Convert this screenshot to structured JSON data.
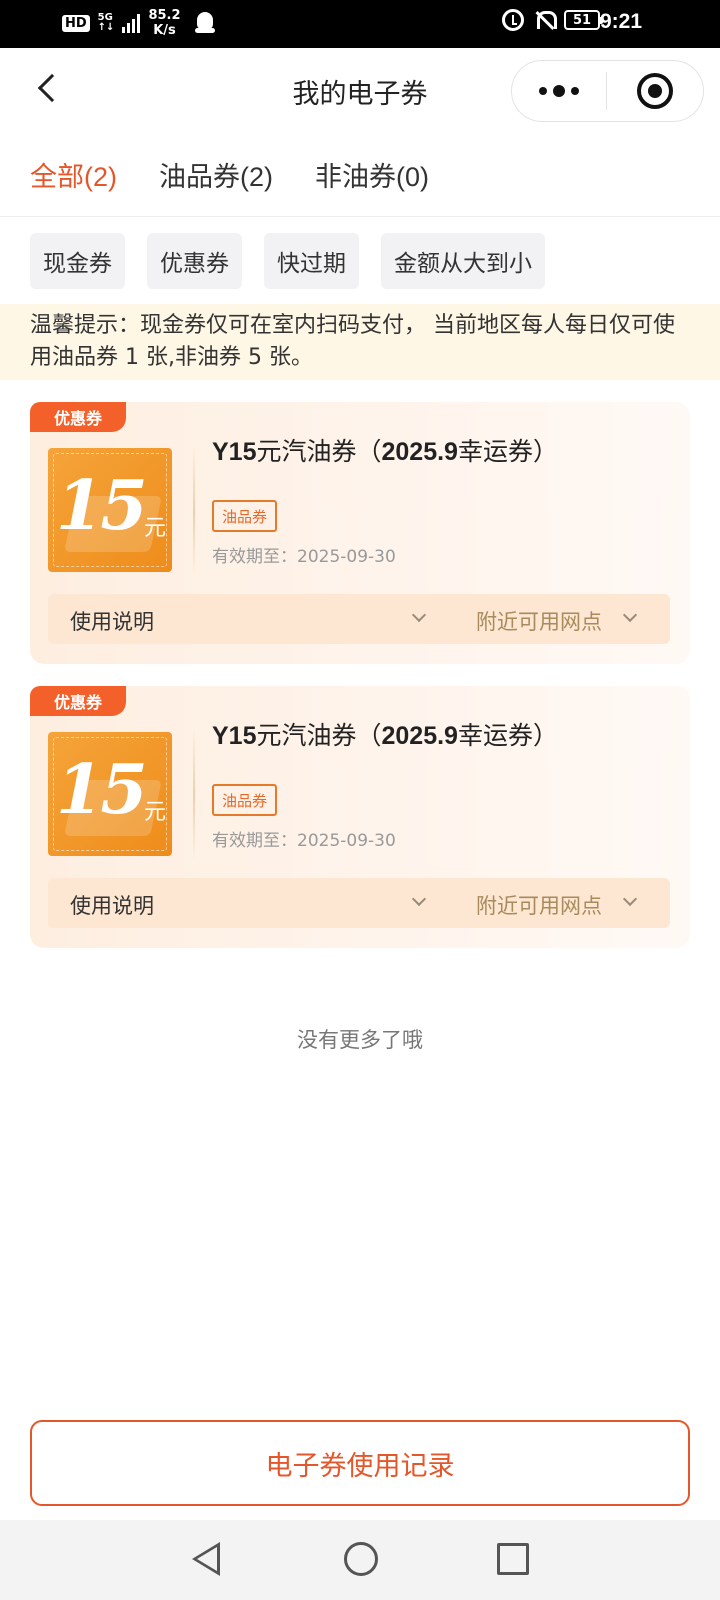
{
  "status_bar": {
    "hd": "HD",
    "net_type": "5G",
    "net_type_sub": "↑↓",
    "speed_value": "85.2",
    "speed_unit": "K/s",
    "battery": "51",
    "time": "9:21"
  },
  "nav": {
    "title": "我的电子券"
  },
  "tabs": [
    {
      "label": "全部(2)",
      "active": true
    },
    {
      "label": "油品券(2)",
      "active": false
    },
    {
      "label": "非油券(0)",
      "active": false
    }
  ],
  "filters": [
    "现金券",
    "优惠券",
    "快过期",
    "金额从大到小"
  ],
  "notice": "温馨提示：现金券仅可在室内扫码支付， 当前地区每人每日仅可使用油品券 1 张,非油券 5 张。",
  "coupons": [
    {
      "tag": "优惠券",
      "amount": "15",
      "unit": "元",
      "title_prefix": "Y15",
      "title_mid": "元汽油券（",
      "title_bold": "2025.9",
      "title_suffix": "幸运券）",
      "type": "油品券",
      "expiry": "有效期至：2025-09-30",
      "usage_label": "使用说明",
      "nearby_label": "附近可用网点"
    },
    {
      "tag": "优惠券",
      "amount": "15",
      "unit": "元",
      "title_prefix": "Y15",
      "title_mid": "元汽油券（",
      "title_bold": "2025.9",
      "title_suffix": "幸运券）",
      "type": "油品券",
      "expiry": "有效期至：2025-09-30",
      "usage_label": "使用说明",
      "nearby_label": "附近可用网点"
    }
  ],
  "no_more": "没有更多了哦",
  "record_button": "电子券使用记录",
  "colors": {
    "accent": "#e5572a",
    "tag": "#f4602a",
    "amount_box": "#ee8c1a",
    "notice_bg": "#fff7e6"
  },
  "icons": [
    "hd-icon",
    "signal-icon",
    "qq-icon",
    "alarm-icon",
    "mute-bell-icon",
    "battery-icon",
    "back-icon",
    "more-icon",
    "target-icon",
    "chevron-down-icon",
    "nav-back-icon",
    "nav-home-icon",
    "nav-recent-icon"
  ]
}
